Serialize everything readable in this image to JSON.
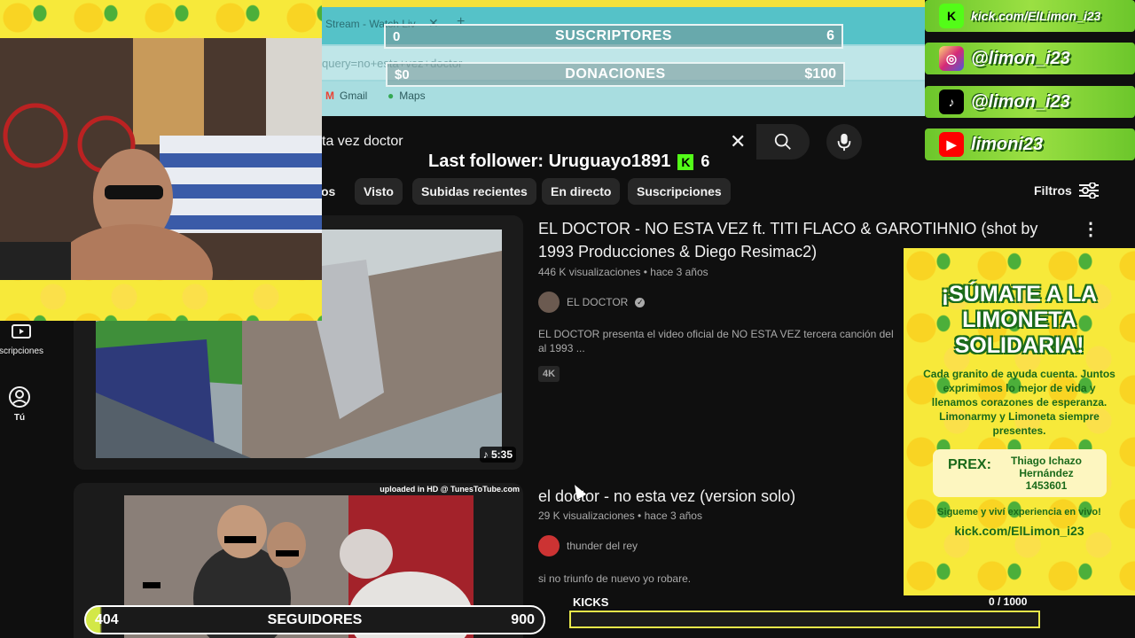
{
  "browser": {
    "tab_title": "Stream - Watch Liv",
    "url": "query=no+esta+vez+doctor",
    "bookmarks": [
      {
        "label": "Gmail",
        "color": "#ea4335"
      },
      {
        "label": "Maps",
        "color": "#34a853"
      }
    ]
  },
  "overlay": {
    "suscriptores": {
      "left": "0",
      "label": "SUSCRIPTORES",
      "right": "6"
    },
    "donaciones": {
      "left": "$0",
      "label": "DONACIONES",
      "right": "$100"
    },
    "last_follower": "Last follower: Uruguayo1891",
    "kick_count": "6",
    "kick_letter": "K"
  },
  "search": {
    "query": "ta vez doctor"
  },
  "chips": [
    "os",
    "Visto",
    "Subidas recientes",
    "En directo",
    "Suscripciones"
  ],
  "filters_label": "Filtros",
  "guide": {
    "subs_label": "scripciones",
    "you_label": "Tú"
  },
  "results": [
    {
      "title": "EL DOCTOR - NO ESTA VEZ ft. TITI FLACO & GAROTIHNIO (shot by 1993 Producciones & Diego Resimac2)",
      "meta": "446 K visualizaciones • hace 3 años",
      "channel": "EL DOCTOR",
      "desc": "EL DOCTOR presenta el video oficial de NO ESTA VEZ tercera canción del al 1993 ...",
      "badge": "4K",
      "duration": "5:35"
    },
    {
      "title": "el doctor - no esta vez (version solo)",
      "meta": "29 K visualizaciones • hace 3 años",
      "channel": "thunder del rey",
      "desc": "si no triunfo de nuevo yo robare.",
      "uploaded": "uploaded in HD @ TunesToTube.com"
    }
  ],
  "social": [
    {
      "text": "kick.com/ElLimon_i23",
      "icon": "kick-icon",
      "color": "#53fc18"
    },
    {
      "text": "@limon_i23",
      "icon": "instagram-icon",
      "color": "#d6249f"
    },
    {
      "text": "@limon_i23",
      "icon": "tiktok-icon",
      "color": "#000000"
    },
    {
      "text": "limoni23",
      "icon": "youtube-icon",
      "color": "#ff0000"
    }
  ],
  "limoneta": {
    "title": "¡SÚMATE A LA LIMONETA SOLIDARIA!",
    "text": "Cada granito de ayuda cuenta. Juntos exprimimos lo mejor de vida y llenamos corazones de esperanza. Limonarmy y Limoneta siempre presentes.",
    "prex_label": "PREX:",
    "prex_name": "Thiago Ichazo Hernández",
    "prex_number": "1453601",
    "foot": "Sigueme y viví experiencia en vivo!",
    "link": "kick.com/ElLimon_i23"
  },
  "bottom": {
    "seguidores": {
      "left": "404",
      "label": "SEGUIDORES",
      "right": "900"
    },
    "kicks_label": "KICKS",
    "kicks_count": "0  / 1000",
    "kicks_progress": 0
  },
  "colors": {
    "youtube_bg": "#0f0f0f",
    "kick_green": "#53fc18",
    "lemon_yellow": "#f7e93a",
    "chrome_teal": "#55c2c8"
  }
}
